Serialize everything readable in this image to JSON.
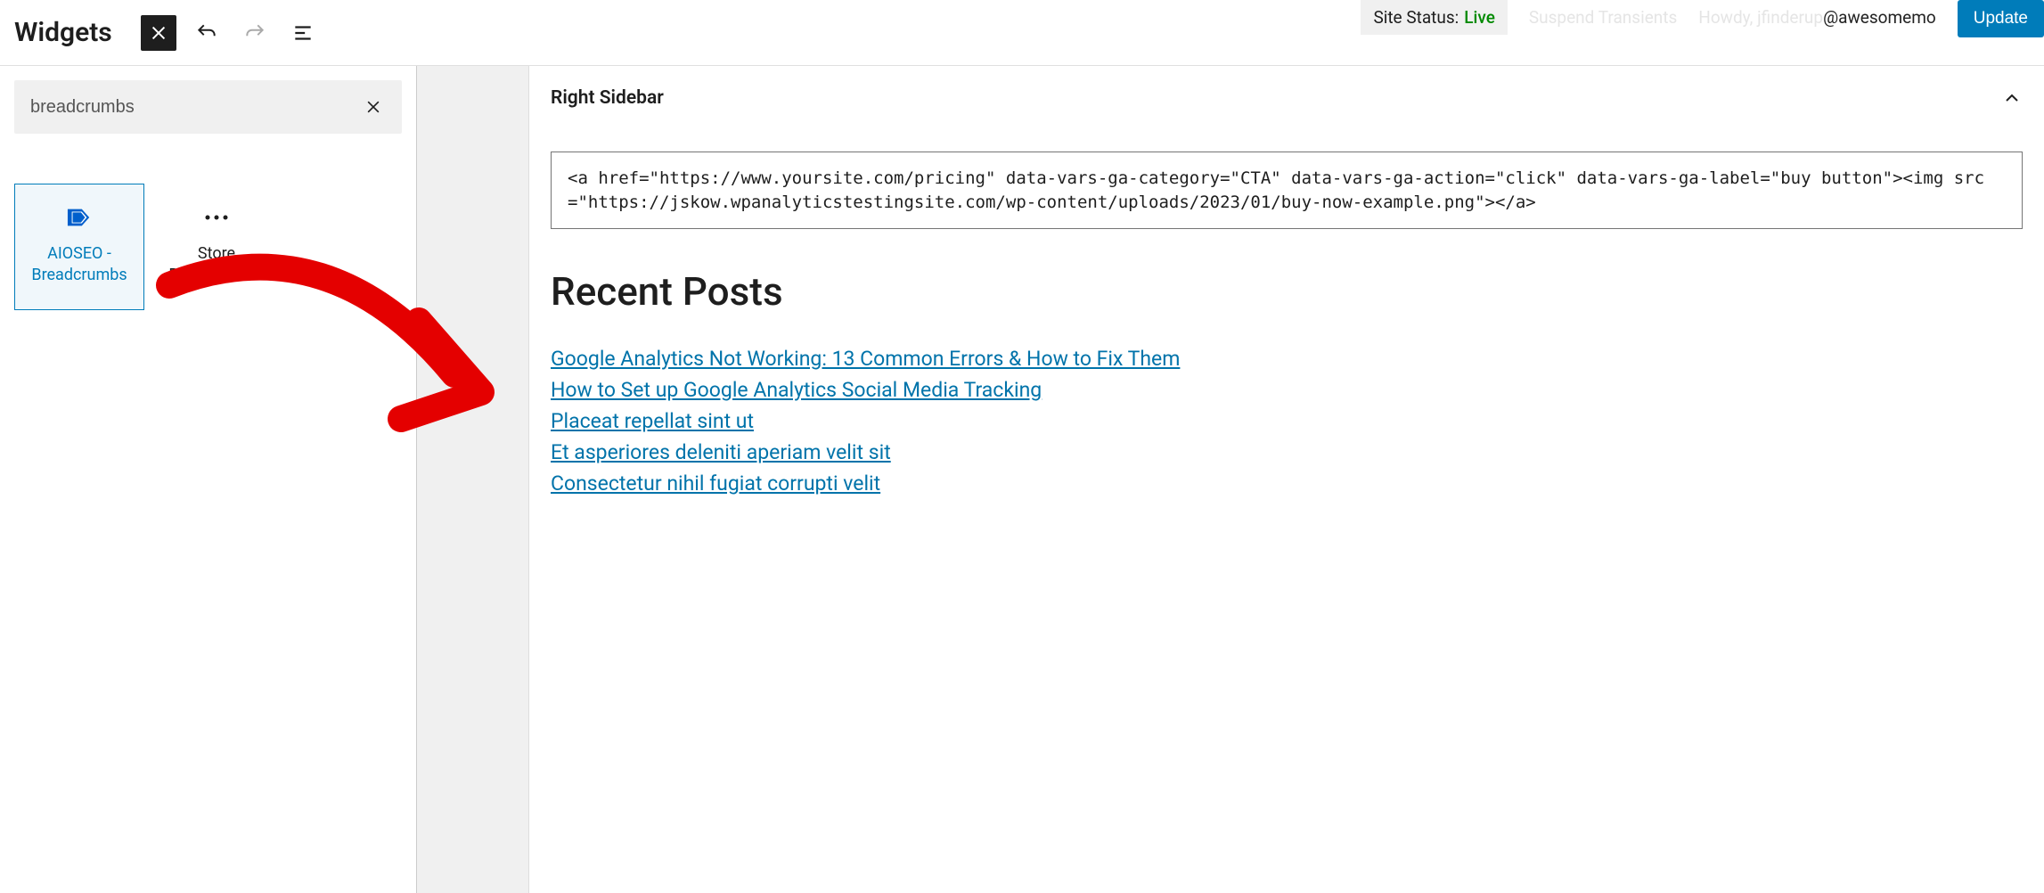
{
  "topbar": {
    "title": "Widgets",
    "site_status_label": "Site Status:",
    "site_status_value": "Live",
    "suspend_label": "Suspend Transients",
    "howdy_label": "Howdy, jfinderup",
    "howdy_suffix": "@awesomemo",
    "update_label": "Update"
  },
  "search": {
    "value": "breadcrumbs"
  },
  "blocks": [
    {
      "label": "AIOSEO - Breadcrumbs",
      "selected": true,
      "icon": "aioseo"
    },
    {
      "label": "Store Breadcrumbs",
      "selected": false,
      "icon": "ellipsis"
    }
  ],
  "area": {
    "title": "Right Sidebar",
    "code": "<a href=\"https://www.yoursite.com/pricing\" data-vars-ga-category=\"CTA\" data-vars-ga-action=\"click\" data-vars-ga-label=\"buy button\"><img src=\"https://jskow.wpanalyticstestingsite.com/wp-content/uploads/2023/01/buy-now-example.png\"></a>"
  },
  "recent": {
    "heading": "Recent Posts",
    "posts": [
      "Google Analytics Not Working: 13 Common Errors & How to Fix Them",
      "How to Set up Google Analytics Social Media Tracking",
      "Placeat repellat sint ut",
      "Et asperiores deleniti aperiam velit sit",
      "Consectetur nihil fugiat corrupti velit"
    ]
  }
}
